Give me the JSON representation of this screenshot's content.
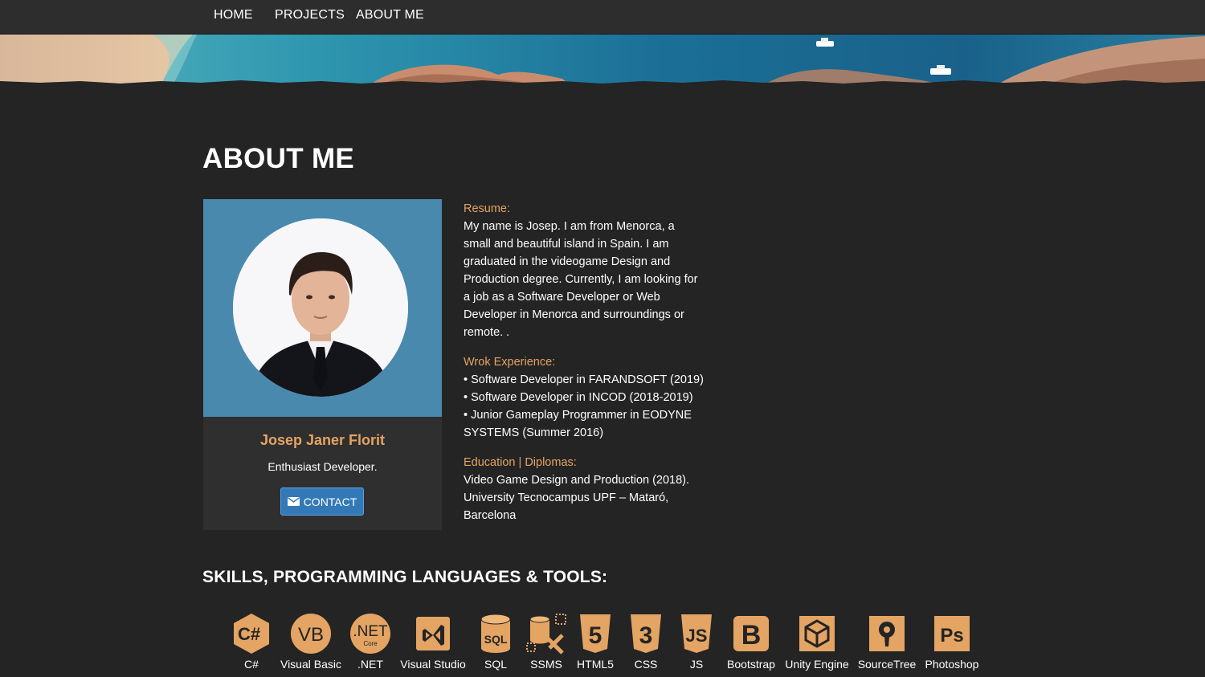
{
  "nav": {
    "items": [
      {
        "label": "HOME"
      },
      {
        "label": "PROJECTS"
      },
      {
        "label": "ABOUT ME"
      }
    ]
  },
  "page": {
    "title": "ABOUT ME"
  },
  "profile": {
    "name": "Josep Janer Florit",
    "tagline": "Enthusiast Developer.",
    "contact_label": "CONTACT",
    "contact_icon": "envelope-icon"
  },
  "info": {
    "resume": {
      "label": "Resume:",
      "text": "My name is Josep. I am from Menorca, a small and beautiful island in Spain. I am graduated in the videogame Design and Production degree. Currently, I am looking for a job as a Software Developer or Web Developer in Menorca and surroundings or remote. ."
    },
    "experience": {
      "label": "Wrok Experience:",
      "items": [
        "• Software Developer in FARANDSOFT (2019)",
        "• Software Developer in INCOD (2018-2019)",
        "• Junior Gameplay Programmer in EODYNE SYSTEMS (Summer 2016)"
      ]
    },
    "education": {
      "label": "Education | Diplomas:",
      "text": "Video Game Design and Production (2018). University Tecnocampus UPF – Mataró, Barcelona"
    }
  },
  "skills": {
    "title": "SKILLS, PROGRAMMING LANGUAGES & TOOLS:",
    "items": [
      {
        "label": "C#",
        "icon": "csharp-icon",
        "glyph": "C#"
      },
      {
        "label": "Visual Basic",
        "icon": "visual-basic-icon",
        "glyph": "VB"
      },
      {
        "label": ".NET",
        "icon": "dotnet-core-icon",
        "glyph": ".NET",
        "sub": "Core"
      },
      {
        "label": "Visual Studio",
        "icon": "visual-studio-icon",
        "glyph": ""
      },
      {
        "label": "SQL",
        "icon": "sql-icon",
        "glyph": "SQL"
      },
      {
        "label": "SSMS",
        "icon": "ssms-icon",
        "glyph": ""
      },
      {
        "label": "HTML5",
        "icon": "html5-icon",
        "glyph": "5"
      },
      {
        "label": "CSS",
        "icon": "css3-icon",
        "glyph": "3"
      },
      {
        "label": "JS",
        "icon": "javascript-icon",
        "glyph": "JS"
      },
      {
        "label": "Bootstrap",
        "icon": "bootstrap-icon",
        "glyph": "B"
      },
      {
        "label": "Unity Engine",
        "icon": "unity-icon",
        "glyph": ""
      },
      {
        "label": "SourceTree",
        "icon": "sourcetree-icon",
        "glyph": ""
      },
      {
        "label": "Photoshop",
        "icon": "photoshop-icon",
        "glyph": "Ps"
      }
    ]
  },
  "colors": {
    "accent": "#e4a463",
    "photo_bg": "#4a89ae",
    "button": "#3479b7",
    "page_bg": "#242424",
    "nav_bg": "#2d2d2d",
    "icon_fill": "#e4a463"
  }
}
